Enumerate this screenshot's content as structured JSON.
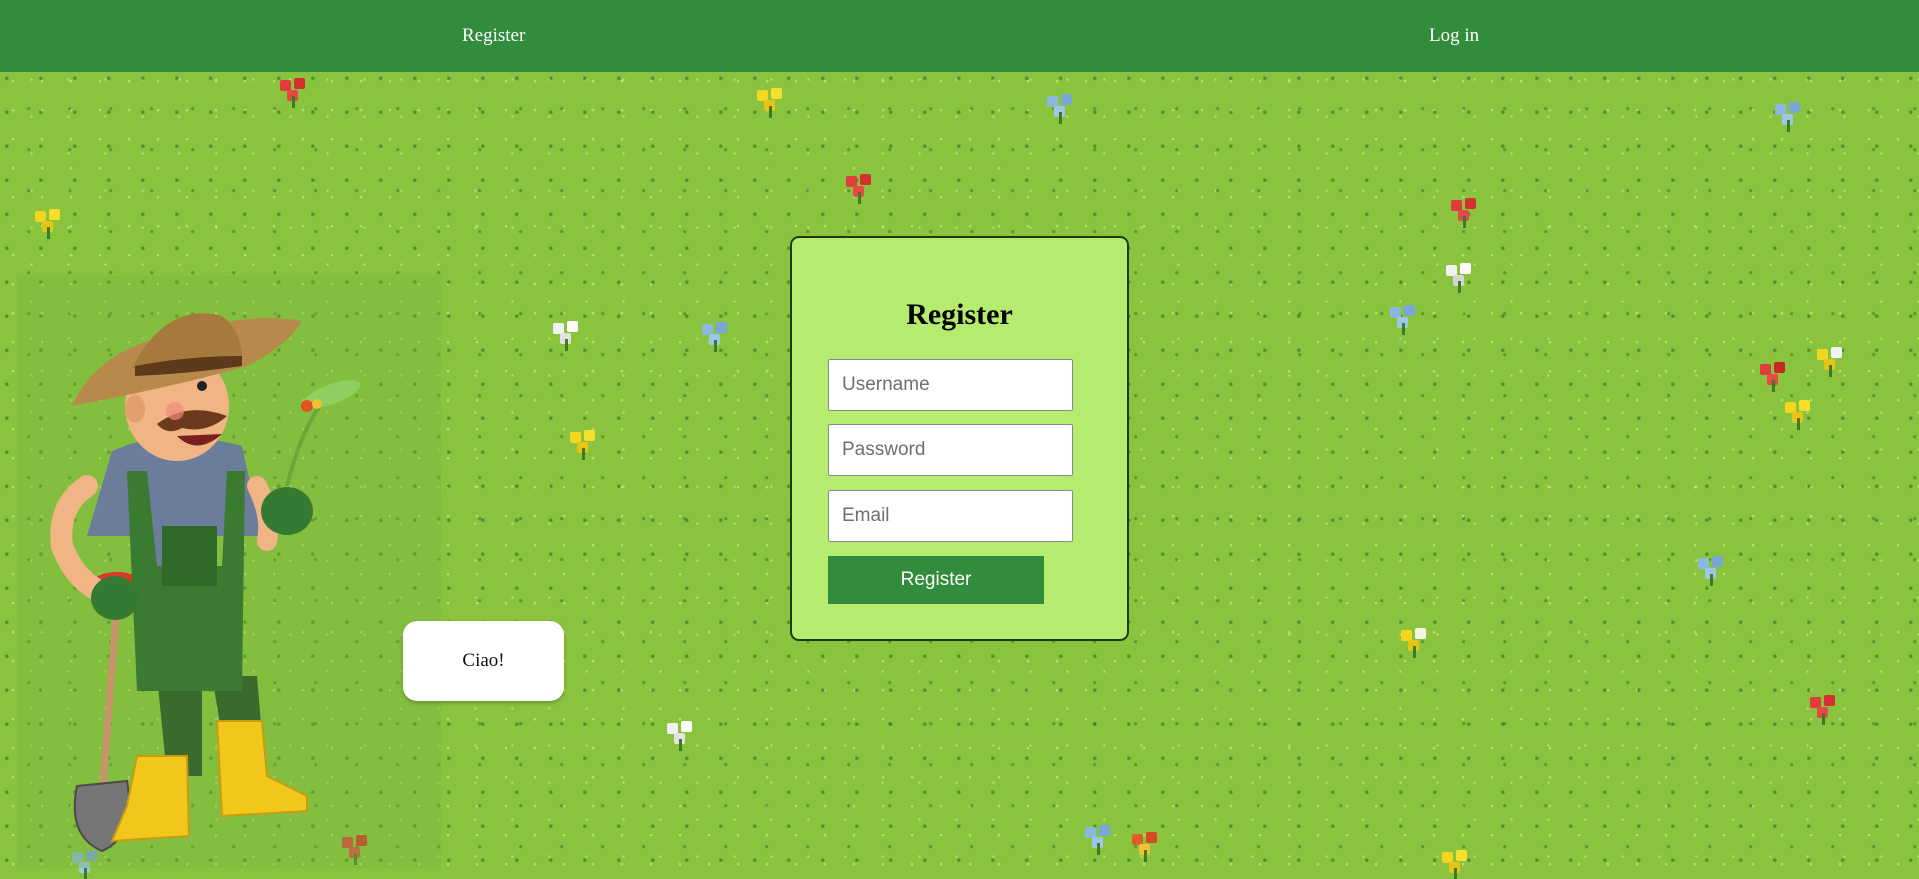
{
  "nav": {
    "register_label": "Register",
    "login_label": "Log in"
  },
  "speech_bubble": {
    "text": "Ciao!"
  },
  "form": {
    "title": "Register",
    "username_placeholder": "Username",
    "password_placeholder": "Password",
    "email_placeholder": "Email",
    "submit_label": "Register"
  },
  "colors": {
    "nav_background": "#318c3b",
    "grass": "#8ac43f",
    "card_background": "#b5ec6f",
    "button": "#318c3b"
  },
  "icons": {
    "farmer": "farmer-illustration",
    "flowers": "pixel-flower-icon"
  }
}
